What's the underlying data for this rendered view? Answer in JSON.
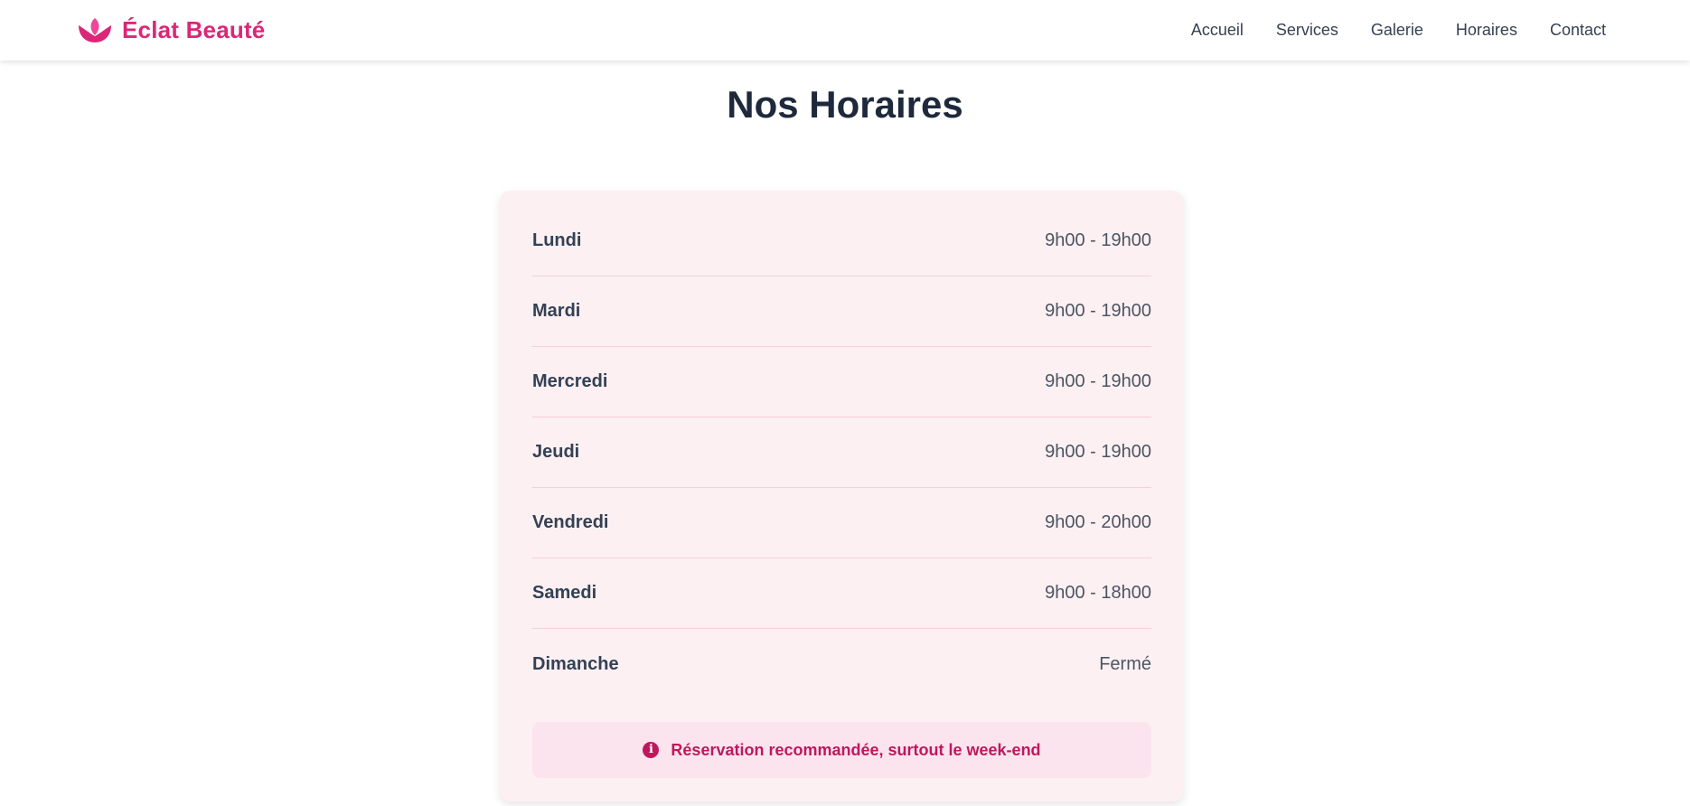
{
  "brand": {
    "name": "Éclat Beauté",
    "icon": "lotus-icon",
    "color": "#db2777"
  },
  "nav": {
    "links": [
      {
        "label": "Accueil"
      },
      {
        "label": "Services"
      },
      {
        "label": "Galerie"
      },
      {
        "label": "Horaires"
      },
      {
        "label": "Contact"
      }
    ]
  },
  "page": {
    "title": "Nos Horaires"
  },
  "hours": [
    {
      "day": "Lundi",
      "time": "9h00 - 19h00"
    },
    {
      "day": "Mardi",
      "time": "9h00 - 19h00"
    },
    {
      "day": "Mercredi",
      "time": "9h00 - 19h00"
    },
    {
      "day": "Jeudi",
      "time": "9h00 - 19h00"
    },
    {
      "day": "Vendredi",
      "time": "9h00 - 20h00"
    },
    {
      "day": "Samedi",
      "time": "9h00 - 18h00"
    },
    {
      "day": "Dimanche",
      "time": "Fermé"
    }
  ],
  "notice": {
    "icon": "info-icon",
    "text": "Réservation recommandée, surtout le week-end"
  },
  "colors": {
    "accent": "#db2777",
    "card_background": "#fdf0f2",
    "notice_background": "#fce4ef",
    "notice_text": "#be185d"
  }
}
